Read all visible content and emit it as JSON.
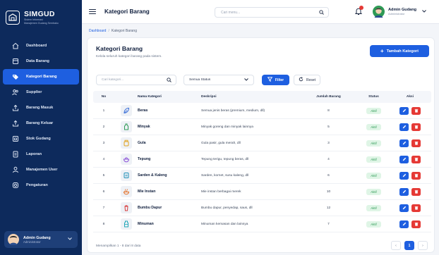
{
  "brand": {
    "name": "SIMGUD",
    "sub1": "Sistem Informasi",
    "sub2": "Manajemen Gudang Sembako"
  },
  "sidebar": {
    "items": [
      {
        "label": "Dashboard",
        "icon": "home-icon"
      },
      {
        "label": "Data Barang",
        "icon": "box-icon"
      },
      {
        "label": "Kategori Barang",
        "icon": "tag-icon",
        "active": true
      },
      {
        "label": "Supplier",
        "icon": "users-icon"
      },
      {
        "label": "Barang Masuk",
        "icon": "upload-icon"
      },
      {
        "label": "Barang Keluar",
        "icon": "upload-icon"
      },
      {
        "label": "Stok Gudang",
        "icon": "warehouse-icon"
      },
      {
        "label": "Laporan",
        "icon": "report-icon"
      },
      {
        "label": "Manajemen User",
        "icon": "user-icon"
      },
      {
        "label": "Pengaturan",
        "icon": "gear-icon"
      }
    ],
    "user": {
      "name": "Admin Gudang",
      "role": "Administrator"
    }
  },
  "topbar": {
    "title": "Kategori Barang",
    "search_placeholder": "Cari menu...",
    "user": {
      "name": "Admin Gudang",
      "role": "Administrator"
    }
  },
  "breadcrumb": {
    "home": "Dashboard",
    "sep": "/",
    "current": "Kategori Barang"
  },
  "page": {
    "title": "Kategori Barang",
    "subtitle": "Kelola seluruh kategori barang pada sistem.",
    "add_button": "Tambah Kategori",
    "add_plus": "+"
  },
  "filters": {
    "search_placeholder": "Cari kategori...",
    "status_value": "Semua Status",
    "filter_button": "Filter",
    "reset_button": "Reset"
  },
  "table": {
    "headers": {
      "no": "No",
      "name": "Nama Kategori",
      "desc": "Deskripsi",
      "qty": "Jumlah Barang",
      "status": "Status",
      "action": "Aksi"
    },
    "rows": [
      {
        "no": "1",
        "name": "Beras",
        "desc": "Semua jenis beras (premium, medium, dll)",
        "qty": "8",
        "status": "Aktif",
        "icon": "leaf-icon",
        "color": "#3b6fd8"
      },
      {
        "no": "2",
        "name": "Minyak",
        "desc": "Minyak goreng dan minyak lainnya",
        "qty": "5",
        "status": "Aktif",
        "icon": "bottle-icon",
        "color": "#2e9a55"
      },
      {
        "no": "3",
        "name": "Gula",
        "desc": "Gula pasir, gula merah, dll",
        "qty": "3",
        "status": "Aktif",
        "icon": "jar-icon",
        "color": "#e0a21e"
      },
      {
        "no": "4",
        "name": "Tepung",
        "desc": "Tepung terigu, tepung beras, dll",
        "qty": "4",
        "status": "Aktif",
        "icon": "bowl-icon",
        "color": "#8a4fd8"
      },
      {
        "no": "5",
        "name": "Sarden & Kaleng",
        "desc": "Sarden, kornet, susu kaleng, dll",
        "qty": "6",
        "status": "Aktif",
        "icon": "can-icon",
        "color": "#1e8fb8"
      },
      {
        "no": "6",
        "name": "Mie Instan",
        "desc": "Mie instan berbagai merek",
        "qty": "10",
        "status": "Aktif",
        "icon": "noodle-icon",
        "color": "#e36a1e"
      },
      {
        "no": "7",
        "name": "Bumbu Dapur",
        "desc": "Bumbu dapur, penyedap, saus, dll",
        "qty": "12",
        "status": "Aktif",
        "icon": "spice-icon",
        "color": "#d83b3b"
      },
      {
        "no": "8",
        "name": "Minuman",
        "desc": "Minuman kemasan dan lainnya",
        "qty": "7",
        "status": "Aktif",
        "icon": "drink-icon",
        "color": "#1ea6b8"
      }
    ]
  },
  "footer": {
    "info": "Menampilkan 1 - 8 dari 8 data",
    "pages": {
      "prev": "‹",
      "current": "1",
      "next": "›"
    }
  },
  "colors": {
    "primary": "#1e5fe0",
    "sidebar": "#0d2a5c",
    "danger": "#e53935",
    "success": "#2e9a55"
  }
}
